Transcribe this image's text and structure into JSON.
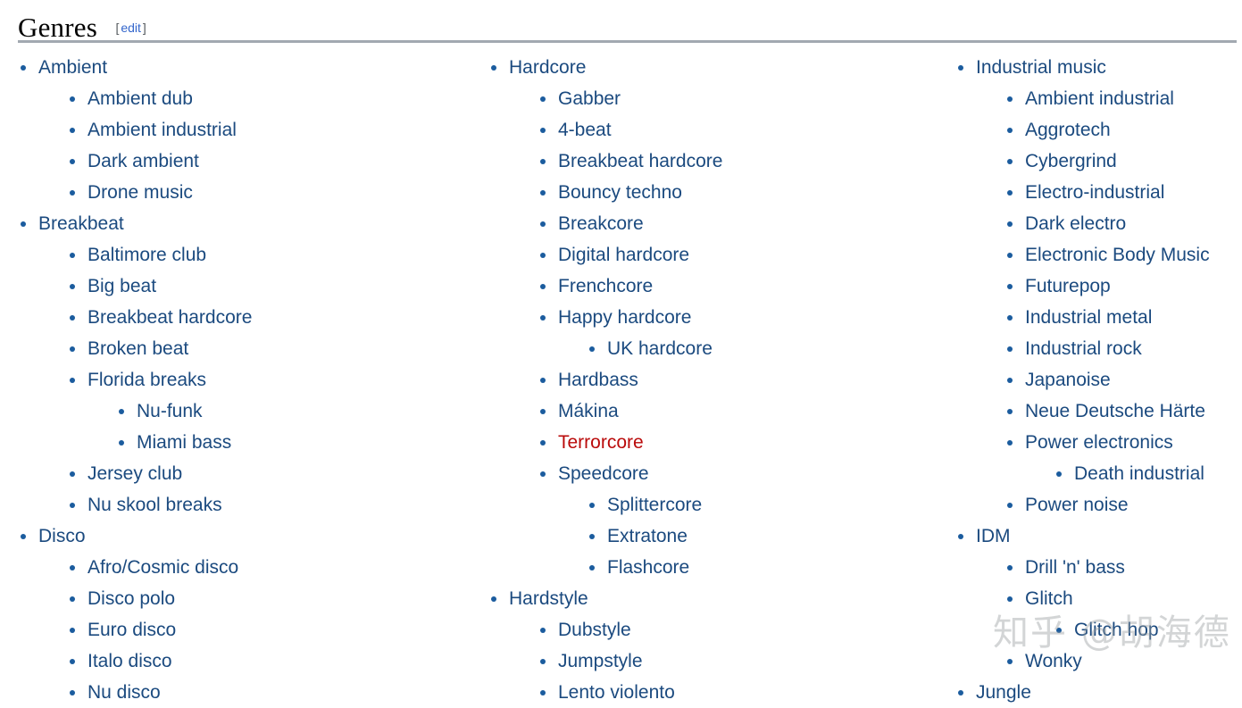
{
  "header": {
    "title": "Genres",
    "edit_open_bracket": "[",
    "edit_label": "edit",
    "edit_close_bracket": "]"
  },
  "watermark": {
    "text": "知乎 @胡海德"
  },
  "colors": {
    "link": "#1b4a7f",
    "redlink": "#ba0b0b",
    "edit_link": "#3366cc",
    "bullet": "#1b5c9e",
    "rule": "#a2a9b1",
    "background": "#ffffff",
    "watermark": "rgba(150,154,158,0.42)"
  },
  "columns": [
    {
      "id": "column-1",
      "items": [
        {
          "label": "Ambient",
          "level": 1,
          "redlink": false
        },
        {
          "label": "Ambient dub",
          "level": 2,
          "redlink": false
        },
        {
          "label": "Ambient industrial",
          "level": 2,
          "redlink": false
        },
        {
          "label": "Dark ambient",
          "level": 2,
          "redlink": false
        },
        {
          "label": "Drone music",
          "level": 2,
          "redlink": false
        },
        {
          "label": "Breakbeat",
          "level": 1,
          "redlink": false
        },
        {
          "label": "Baltimore club",
          "level": 2,
          "redlink": false
        },
        {
          "label": "Big beat",
          "level": 2,
          "redlink": false
        },
        {
          "label": "Breakbeat hardcore",
          "level": 2,
          "redlink": false
        },
        {
          "label": "Broken beat",
          "level": 2,
          "redlink": false
        },
        {
          "label": "Florida breaks",
          "level": 2,
          "redlink": false
        },
        {
          "label": "Nu-funk",
          "level": 3,
          "redlink": false
        },
        {
          "label": "Miami bass",
          "level": 3,
          "redlink": false
        },
        {
          "label": "Jersey club",
          "level": 2,
          "redlink": false
        },
        {
          "label": "Nu skool breaks",
          "level": 2,
          "redlink": false
        },
        {
          "label": "Disco",
          "level": 1,
          "redlink": false
        },
        {
          "label": "Afro/Cosmic disco",
          "level": 2,
          "redlink": false
        },
        {
          "label": "Disco polo",
          "level": 2,
          "redlink": false
        },
        {
          "label": "Euro disco",
          "level": 2,
          "redlink": false
        },
        {
          "label": "Italo disco",
          "level": 2,
          "redlink": false
        },
        {
          "label": "Nu disco",
          "level": 2,
          "redlink": false
        }
      ]
    },
    {
      "id": "column-2",
      "items": [
        {
          "label": "Hardcore",
          "level": 1,
          "redlink": false
        },
        {
          "label": "Gabber",
          "level": 2,
          "redlink": false
        },
        {
          "label": "4-beat",
          "level": 2,
          "redlink": false
        },
        {
          "label": "Breakbeat hardcore",
          "level": 2,
          "redlink": false
        },
        {
          "label": "Bouncy techno",
          "level": 2,
          "redlink": false
        },
        {
          "label": "Breakcore",
          "level": 2,
          "redlink": false
        },
        {
          "label": "Digital hardcore",
          "level": 2,
          "redlink": false
        },
        {
          "label": "Frenchcore",
          "level": 2,
          "redlink": false
        },
        {
          "label": "Happy hardcore",
          "level": 2,
          "redlink": false
        },
        {
          "label": "UK hardcore",
          "level": 3,
          "redlink": false
        },
        {
          "label": "Hardbass",
          "level": 2,
          "redlink": false
        },
        {
          "label": "Mákina",
          "level": 2,
          "redlink": false
        },
        {
          "label": "Terrorcore",
          "level": 2,
          "redlink": true
        },
        {
          "label": "Speedcore",
          "level": 2,
          "redlink": false
        },
        {
          "label": "Splittercore",
          "level": 3,
          "redlink": false
        },
        {
          "label": "Extratone",
          "level": 3,
          "redlink": false
        },
        {
          "label": "Flashcore",
          "level": 3,
          "redlink": false
        },
        {
          "label": "Hardstyle",
          "level": 1,
          "redlink": false
        },
        {
          "label": "Dubstyle",
          "level": 2,
          "redlink": false
        },
        {
          "label": "Jumpstyle",
          "level": 2,
          "redlink": false
        },
        {
          "label": "Lento violento",
          "level": 2,
          "redlink": false
        }
      ]
    },
    {
      "id": "column-3",
      "items": [
        {
          "label": "Industrial music",
          "level": 1,
          "redlink": false
        },
        {
          "label": "Ambient industrial",
          "level": 2,
          "redlink": false
        },
        {
          "label": "Aggrotech",
          "level": 2,
          "redlink": false
        },
        {
          "label": "Cybergrind",
          "level": 2,
          "redlink": false
        },
        {
          "label": "Electro-industrial",
          "level": 2,
          "redlink": false
        },
        {
          "label": "Dark electro",
          "level": 2,
          "redlink": false
        },
        {
          "label": "Electronic Body Music",
          "level": 2,
          "redlink": false
        },
        {
          "label": "Futurepop",
          "level": 2,
          "redlink": false
        },
        {
          "label": "Industrial metal",
          "level": 2,
          "redlink": false
        },
        {
          "label": "Industrial rock",
          "level": 2,
          "redlink": false
        },
        {
          "label": "Japanoise",
          "level": 2,
          "redlink": false
        },
        {
          "label": "Neue Deutsche Härte",
          "level": 2,
          "redlink": false
        },
        {
          "label": "Power electronics",
          "level": 2,
          "redlink": false
        },
        {
          "label": "Death industrial",
          "level": 3,
          "redlink": false
        },
        {
          "label": "Power noise",
          "level": 2,
          "redlink": false
        },
        {
          "label": "IDM",
          "level": 1,
          "redlink": false
        },
        {
          "label": "Drill 'n' bass",
          "level": 2,
          "redlink": false
        },
        {
          "label": "Glitch",
          "level": 2,
          "redlink": false
        },
        {
          "label": "Glitch hop",
          "level": 3,
          "redlink": false
        },
        {
          "label": "Wonky",
          "level": 2,
          "redlink": false
        },
        {
          "label": "Jungle",
          "level": 1,
          "redlink": false
        }
      ]
    }
  ]
}
